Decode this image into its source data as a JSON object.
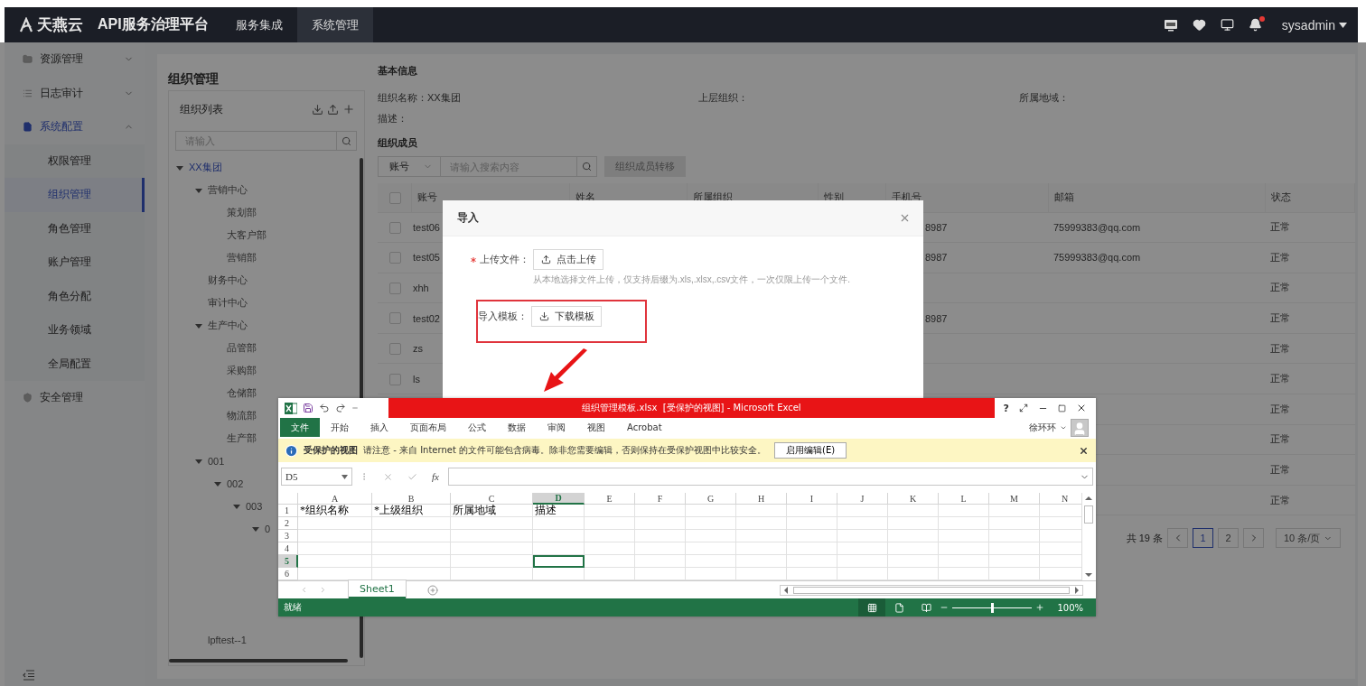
{
  "header": {
    "logo_text": "天燕云",
    "title": "API服务治理平台",
    "nav": [
      {
        "label": "服务集成",
        "selected": false
      },
      {
        "label": "系统管理",
        "selected": true
      }
    ],
    "notification_dot": true,
    "user": "sysadmin"
  },
  "sidebar": {
    "items": [
      {
        "label": "资源管理",
        "kind": "group",
        "expanded": false,
        "selected": false
      },
      {
        "label": "日志审计",
        "kind": "group",
        "expanded": false,
        "selected": false
      },
      {
        "label": "系统配置",
        "kind": "group",
        "expanded": true,
        "selected": true,
        "children": [
          {
            "label": "权限管理",
            "selected": false
          },
          {
            "label": "组织管理",
            "selected": true
          },
          {
            "label": "角色管理",
            "selected": false
          },
          {
            "label": "账户管理",
            "selected": false
          },
          {
            "label": "角色分配",
            "selected": false
          },
          {
            "label": "业务领域",
            "selected": false
          },
          {
            "label": "全局配置",
            "selected": false
          }
        ]
      },
      {
        "label": "安全管理",
        "kind": "link",
        "selected": false
      }
    ]
  },
  "org_panel": {
    "title": "组织管理",
    "list_title": "组织列表",
    "search_placeholder": "请输入",
    "tree": [
      {
        "label": "XX集团",
        "selected": true,
        "expanded": true,
        "children": [
          {
            "label": "营销中心",
            "selected": false,
            "expanded": true,
            "children": [
              {
                "label": "策划部",
                "selected": false
              },
              {
                "label": "大客户部",
                "selected": false
              },
              {
                "label": "营销部",
                "selected": false
              }
            ]
          },
          {
            "label": "财务中心",
            "selected": false
          },
          {
            "label": "审计中心",
            "selected": false
          },
          {
            "label": "生产中心",
            "selected": false,
            "expanded": true,
            "children": [
              {
                "label": "品管部",
                "selected": false
              },
              {
                "label": "采购部",
                "selected": false
              },
              {
                "label": "仓储部",
                "selected": false
              },
              {
                "label": "物流部",
                "selected": false
              },
              {
                "label": "生产部",
                "selected": false
              }
            ]
          },
          {
            "label": "001",
            "selected": false,
            "expanded": true,
            "children": [
              {
                "label": "002",
                "selected": false,
                "expanded": true,
                "children": [
                  {
                    "label": "003",
                    "selected": false,
                    "expanded": true,
                    "children": [
                      {
                        "label": "0",
                        "selected": false,
                        "expanded": true
                      }
                    ]
                  }
                ]
              }
            ]
          },
          {
            "label": "lpftest--1",
            "selected": false
          }
        ]
      }
    ]
  },
  "basic_info": {
    "heading": "基本信息",
    "fields": [
      {
        "label": "组织名称：",
        "value": "XX集团"
      },
      {
        "label": "上层组织："
      },
      {
        "label": "所属地域："
      }
    ],
    "description_label": "描述："
  },
  "members": {
    "heading": "组织成员",
    "filter_select": "账号",
    "search_placeholder": "请输入搜索内容",
    "transfer_button": {
      "label": "组织成员转移",
      "disabled": true
    },
    "header_checked": false,
    "columns": [
      "账号",
      "姓名",
      "所属组织",
      "性别",
      "手机号",
      "邮箱",
      "状态"
    ],
    "rows": [
      {
        "checked": false,
        "account": "test06",
        "phone": "8987",
        "email": "75999383@qq.com",
        "status": "正常"
      },
      {
        "checked": false,
        "account": "test05",
        "phone": "8987",
        "email": "75999383@qq.com",
        "status": "正常"
      },
      {
        "checked": false,
        "account": "xhh",
        "status": "正常"
      },
      {
        "checked": false,
        "account": "test02",
        "phone": "8987",
        "status": "正常"
      },
      {
        "checked": false,
        "account": "zs",
        "status": "正常"
      },
      {
        "checked": false,
        "account": "ls",
        "status": "正常"
      },
      {
        "status": "正常"
      },
      {
        "status": "正常"
      },
      {
        "status": "正常"
      },
      {
        "status": "正常"
      }
    ],
    "pagination": {
      "total": "共 19 条",
      "pages": [
        {
          "label": "1",
          "selected": true
        },
        {
          "label": "2",
          "selected": false
        }
      ],
      "page_size": "10 条/页"
    }
  },
  "modal": {
    "title": "导入",
    "upload": {
      "label": "上传文件：",
      "required": true,
      "button": "点击上传",
      "hint": "从本地选择文件上传，仅支持后缀为.xls,.xlsx,.csv文件，一次仅限上传一个文件."
    },
    "template": {
      "label": "导入模板：",
      "button": "下载模板",
      "highlighted": true
    }
  },
  "excel": {
    "title": "组织管理模板.xlsx  [受保护的视图] - Microsoft Excel",
    "help": "?",
    "ribbon_tabs": [
      {
        "label": "文件",
        "selected": true
      },
      {
        "label": "开始",
        "selected": false
      },
      {
        "label": "插入",
        "selected": false
      },
      {
        "label": "页面布局",
        "selected": false
      },
      {
        "label": "公式",
        "selected": false
      },
      {
        "label": "数据",
        "selected": false
      },
      {
        "label": "审阅",
        "selected": false
      },
      {
        "label": "视图",
        "selected": false
      },
      {
        "label": "Acrobat",
        "selected": false
      }
    ],
    "user": "徐环环",
    "protected_bar": {
      "title": "受保护的视图",
      "message": "请注意 - 来自 Internet 的文件可能包含病毒。除非您需要编辑，否则保持在受保护视图中比较安全。",
      "button": "启用编辑(E)"
    },
    "name_box": "D5",
    "function_label": "fx",
    "columns": [
      {
        "label": "A",
        "selected": false
      },
      {
        "label": "B",
        "selected": false
      },
      {
        "label": "C",
        "selected": false
      },
      {
        "label": "D",
        "selected": true
      },
      {
        "label": "E",
        "selected": false
      },
      {
        "label": "F",
        "selected": false
      },
      {
        "label": "G",
        "selected": false
      },
      {
        "label": "H",
        "selected": false
      },
      {
        "label": "I",
        "selected": false
      },
      {
        "label": "J",
        "selected": false
      },
      {
        "label": "K",
        "selected": false
      },
      {
        "label": "L",
        "selected": false
      },
      {
        "label": "M",
        "selected": false
      },
      {
        "label": "N",
        "selected": false
      }
    ],
    "rows": [
      {
        "label": "1",
        "selected": false,
        "cells": [
          "*组织名称",
          "*上级组织",
          "所属地域",
          "描述"
        ]
      },
      {
        "label": "2",
        "selected": false
      },
      {
        "label": "3",
        "selected": false
      },
      {
        "label": "4",
        "selected": false
      },
      {
        "label": "5",
        "selected": true
      },
      {
        "label": "6",
        "selected": false
      }
    ],
    "sheets": [
      {
        "label": "Sheet1",
        "selected": true
      }
    ],
    "status": "就绪",
    "zoom": {
      "level": 0.5,
      "reading": "100%"
    }
  }
}
